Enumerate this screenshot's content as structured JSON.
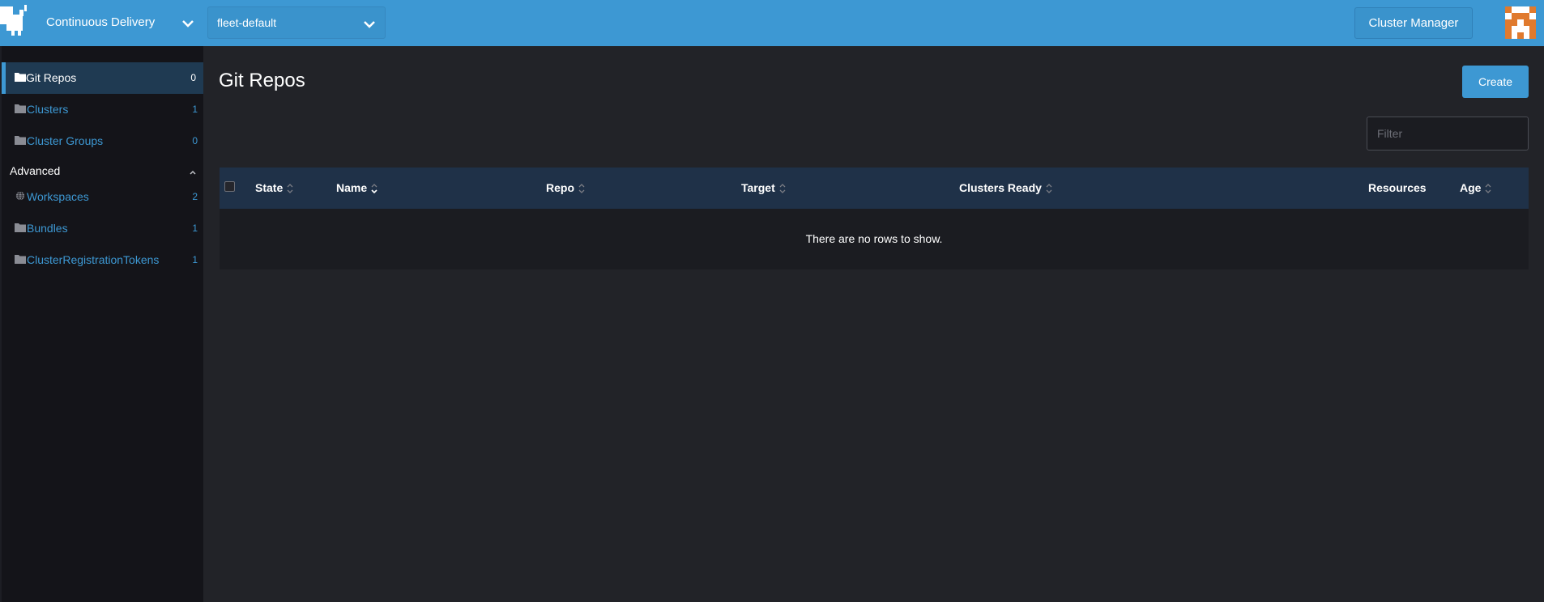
{
  "header": {
    "product": "Continuous Delivery",
    "namespace": "fleet-default",
    "cluster_manager_label": "Cluster Manager"
  },
  "sidebar": {
    "items": [
      {
        "label": "Git Repos",
        "count": "0",
        "icon": "folder-icon",
        "active": true
      },
      {
        "label": "Clusters",
        "count": "1",
        "icon": "folder-icon"
      },
      {
        "label": "Cluster Groups",
        "count": "0",
        "icon": "folder-icon"
      }
    ],
    "advanced": {
      "label": "Advanced",
      "items": [
        {
          "label": "Workspaces",
          "count": "2",
          "icon": "globe-icon"
        },
        {
          "label": "Bundles",
          "count": "1",
          "icon": "folder-icon"
        },
        {
          "label": "ClusterRegistrationTokens",
          "count": "1",
          "icon": "folder-icon"
        }
      ]
    }
  },
  "main": {
    "title": "Git Repos",
    "create_label": "Create",
    "filter_placeholder": "Filter",
    "table": {
      "columns": [
        "State",
        "Name",
        "Repo",
        "Target",
        "Clusters Ready",
        "Resources",
        "Age"
      ],
      "empty_text": "There are no rows to show."
    }
  },
  "colors": {
    "accent": "#3d98d3",
    "background": "#222328",
    "sidebar": "#141419",
    "table_header": "#1f3148"
  }
}
